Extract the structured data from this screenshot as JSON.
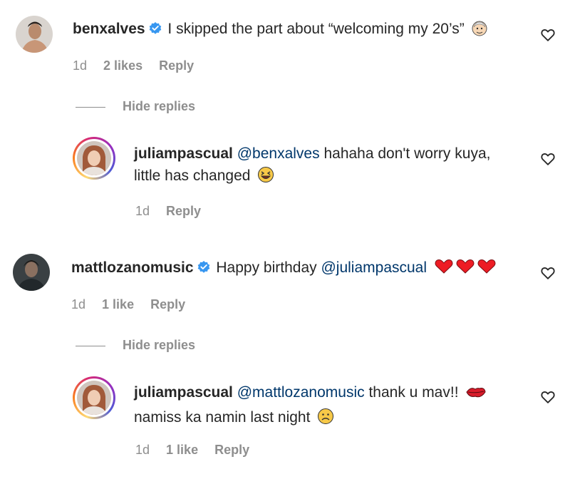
{
  "comments": [
    {
      "username": "benxalves",
      "verified": true,
      "text": "I skipped the part about “welcoming my 20’s”",
      "emoji": "older-person-emoji",
      "time": "1d",
      "likes": "2 likes",
      "reply": "Reply"
    },
    {
      "username": "juliampascual",
      "mention": "@benxalves",
      "text_line1": "hahaha don't worry kuya,",
      "text_line2": "little has changed",
      "emoji": "laughing-emoji",
      "time": "1d",
      "reply": "Reply"
    },
    {
      "username": "mattlozanomusic",
      "verified": true,
      "text": "Happy birthday",
      "mention": "@juliampascual",
      "emoji": "red-hearts-emoji",
      "time": "1d",
      "likes": "1 like",
      "reply": "Reply"
    },
    {
      "username": "juliampascual",
      "mention": "@mattlozanomusic",
      "text_line1": "thank u mav!!",
      "text_line2": "namiss ka namin last night",
      "emoji": "kiss-lips-emoji",
      "emoji2": "frowning-face-emoji",
      "time": "1d",
      "likes": "1 like",
      "reply": "Reply"
    }
  ],
  "hide_replies": "Hide replies",
  "colors": {
    "mention": "#00376b",
    "meta": "#8e8e8e",
    "verified": "#3897f0",
    "heart_red": "#ed1c24"
  }
}
